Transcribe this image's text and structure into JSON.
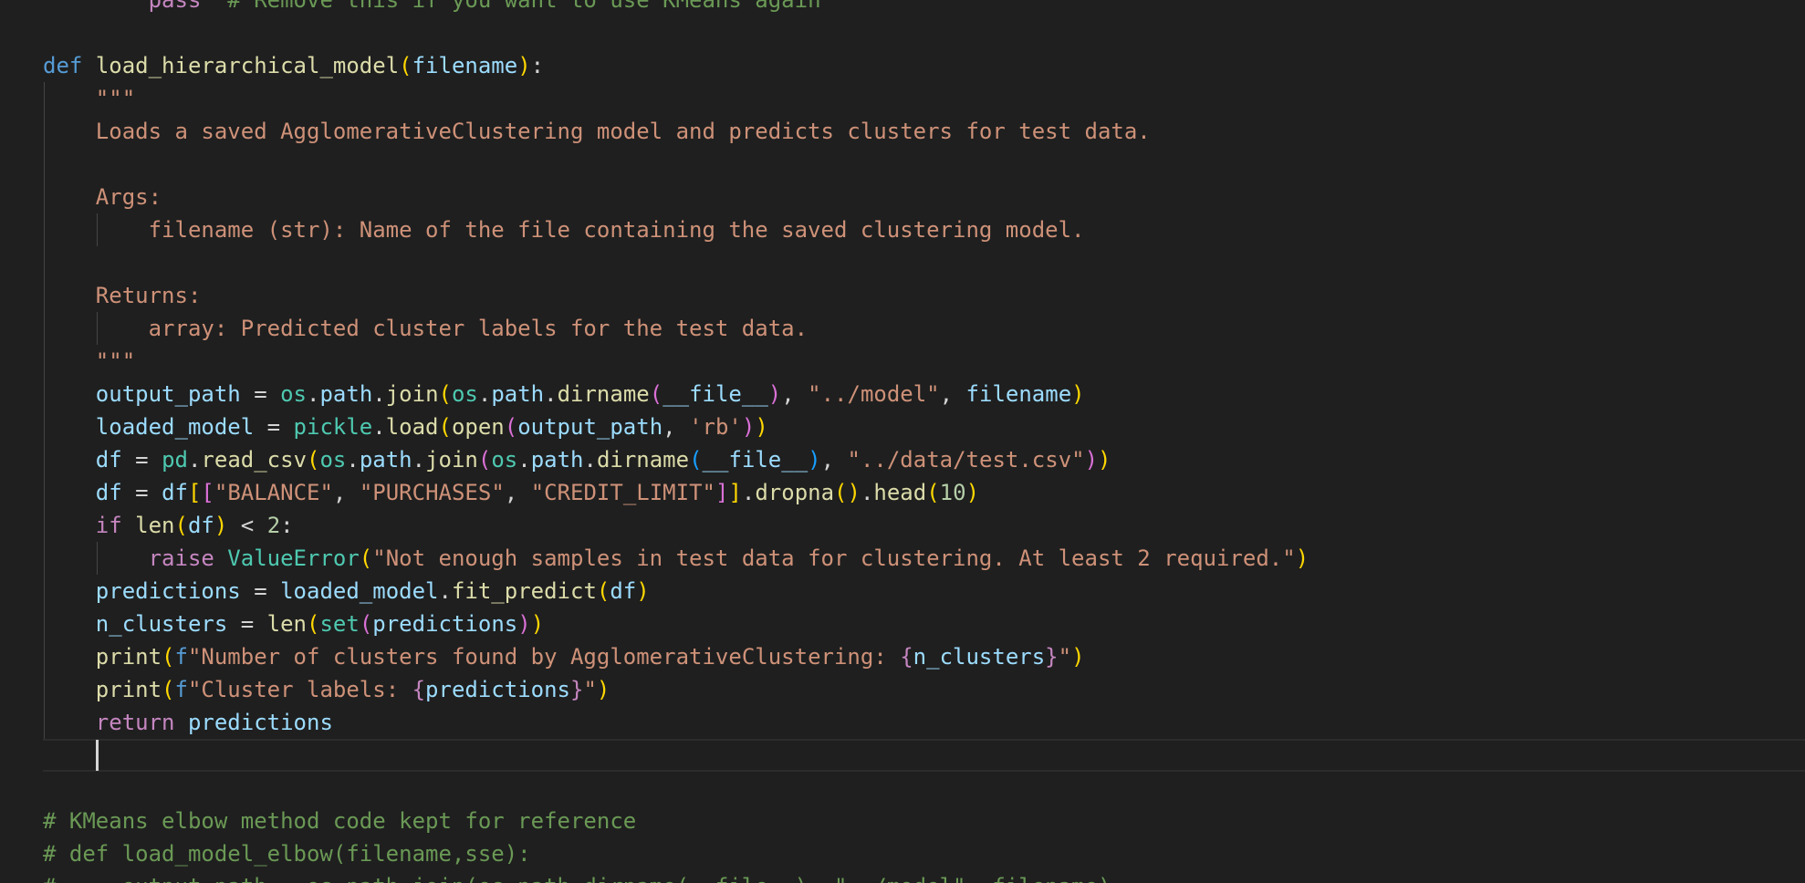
{
  "editor": {
    "theme_colors": {
      "background": "#1f1f1f",
      "keyword_control": "#c586c0",
      "keyword": "#569cd6",
      "function": "#dcdcaa",
      "string": "#ce9178",
      "variable": "#9cdcfe",
      "module": "#4ec9b0",
      "number": "#b5cea8",
      "comment": "#6a9955"
    },
    "lines": [
      [
        {
          "t": "        "
        },
        {
          "t": "pass",
          "c": "kw-ctrl"
        },
        {
          "t": "  "
        },
        {
          "t": "# Remove this if you want to use KMeans again",
          "c": "cmt"
        }
      ],
      [],
      [
        {
          "t": "def",
          "c": "kw"
        },
        {
          "t": " "
        },
        {
          "t": "load_hierarchical_model",
          "c": "fn"
        },
        {
          "t": "(",
          "c": "p1"
        },
        {
          "t": "filename",
          "c": "var"
        },
        {
          "t": ")",
          "c": "p1"
        },
        {
          "t": ":",
          "c": "op"
        }
      ],
      [
        {
          "t": "    "
        },
        {
          "t": "\"\"\"",
          "c": "str"
        }
      ],
      [
        {
          "t": "    "
        },
        {
          "t": "Loads a saved AgglomerativeClustering model and predicts clusters for test data.",
          "c": "str"
        }
      ],
      [],
      [
        {
          "t": "    "
        },
        {
          "t": "Args:",
          "c": "str"
        }
      ],
      [
        {
          "t": "        "
        },
        {
          "t": "filename (str): Name of the file containing the saved clustering model.",
          "c": "str"
        }
      ],
      [],
      [
        {
          "t": "    "
        },
        {
          "t": "Returns:",
          "c": "str"
        }
      ],
      [
        {
          "t": "        "
        },
        {
          "t": "array: Predicted cluster labels for the test data.",
          "c": "str"
        }
      ],
      [
        {
          "t": "    "
        },
        {
          "t": "\"\"\"",
          "c": "str"
        }
      ],
      [
        {
          "t": "    "
        },
        {
          "t": "output_path",
          "c": "var"
        },
        {
          "t": " = ",
          "c": "op"
        },
        {
          "t": "os",
          "c": "mod"
        },
        {
          "t": ".",
          "c": "op"
        },
        {
          "t": "path",
          "c": "var"
        },
        {
          "t": ".",
          "c": "op"
        },
        {
          "t": "join",
          "c": "fn"
        },
        {
          "t": "(",
          "c": "p1"
        },
        {
          "t": "os",
          "c": "mod"
        },
        {
          "t": ".",
          "c": "op"
        },
        {
          "t": "path",
          "c": "var"
        },
        {
          "t": ".",
          "c": "op"
        },
        {
          "t": "dirname",
          "c": "fn"
        },
        {
          "t": "(",
          "c": "p2"
        },
        {
          "t": "__file__",
          "c": "var"
        },
        {
          "t": ")",
          "c": "p2"
        },
        {
          "t": ", ",
          "c": "op"
        },
        {
          "t": "\"../model\"",
          "c": "str"
        },
        {
          "t": ", ",
          "c": "op"
        },
        {
          "t": "filename",
          "c": "var"
        },
        {
          "t": ")",
          "c": "p1"
        }
      ],
      [
        {
          "t": "    "
        },
        {
          "t": "loaded_model",
          "c": "var"
        },
        {
          "t": " = ",
          "c": "op"
        },
        {
          "t": "pickle",
          "c": "mod"
        },
        {
          "t": ".",
          "c": "op"
        },
        {
          "t": "load",
          "c": "fn"
        },
        {
          "t": "(",
          "c": "p1"
        },
        {
          "t": "open",
          "c": "fn"
        },
        {
          "t": "(",
          "c": "p2"
        },
        {
          "t": "output_path",
          "c": "var"
        },
        {
          "t": ", ",
          "c": "op"
        },
        {
          "t": "'rb'",
          "c": "str"
        },
        {
          "t": ")",
          "c": "p2"
        },
        {
          "t": ")",
          "c": "p1"
        }
      ],
      [
        {
          "t": "    "
        },
        {
          "t": "df",
          "c": "var"
        },
        {
          "t": " = ",
          "c": "op"
        },
        {
          "t": "pd",
          "c": "mod"
        },
        {
          "t": ".",
          "c": "op"
        },
        {
          "t": "read_csv",
          "c": "fn"
        },
        {
          "t": "(",
          "c": "p1"
        },
        {
          "t": "os",
          "c": "mod"
        },
        {
          "t": ".",
          "c": "op"
        },
        {
          "t": "path",
          "c": "var"
        },
        {
          "t": ".",
          "c": "op"
        },
        {
          "t": "join",
          "c": "fn"
        },
        {
          "t": "(",
          "c": "p2"
        },
        {
          "t": "os",
          "c": "mod"
        },
        {
          "t": ".",
          "c": "op"
        },
        {
          "t": "path",
          "c": "var"
        },
        {
          "t": ".",
          "c": "op"
        },
        {
          "t": "dirname",
          "c": "fn"
        },
        {
          "t": "(",
          "c": "p3"
        },
        {
          "t": "__file__",
          "c": "var"
        },
        {
          "t": ")",
          "c": "p3"
        },
        {
          "t": ", ",
          "c": "op"
        },
        {
          "t": "\"../data/test.csv\"",
          "c": "str"
        },
        {
          "t": ")",
          "c": "p2"
        },
        {
          "t": ")",
          "c": "p1"
        }
      ],
      [
        {
          "t": "    "
        },
        {
          "t": "df",
          "c": "var"
        },
        {
          "t": " = ",
          "c": "op"
        },
        {
          "t": "df",
          "c": "var"
        },
        {
          "t": "[",
          "c": "p1"
        },
        {
          "t": "[",
          "c": "p2"
        },
        {
          "t": "\"BALANCE\"",
          "c": "str"
        },
        {
          "t": ", ",
          "c": "op"
        },
        {
          "t": "\"PURCHASES\"",
          "c": "str"
        },
        {
          "t": ", ",
          "c": "op"
        },
        {
          "t": "\"CREDIT_LIMIT\"",
          "c": "str"
        },
        {
          "t": "]",
          "c": "p2"
        },
        {
          "t": "]",
          "c": "p1"
        },
        {
          "t": ".",
          "c": "op"
        },
        {
          "t": "dropna",
          "c": "fn"
        },
        {
          "t": "(",
          "c": "p1"
        },
        {
          "t": ")",
          "c": "p1"
        },
        {
          "t": ".",
          "c": "op"
        },
        {
          "t": "head",
          "c": "fn"
        },
        {
          "t": "(",
          "c": "p1"
        },
        {
          "t": "10",
          "c": "num"
        },
        {
          "t": ")",
          "c": "p1"
        }
      ],
      [
        {
          "t": "    "
        },
        {
          "t": "if",
          "c": "kw-ctrl"
        },
        {
          "t": " "
        },
        {
          "t": "len",
          "c": "fn"
        },
        {
          "t": "(",
          "c": "p1"
        },
        {
          "t": "df",
          "c": "var"
        },
        {
          "t": ")",
          "c": "p1"
        },
        {
          "t": " < ",
          "c": "op"
        },
        {
          "t": "2",
          "c": "num"
        },
        {
          "t": ":",
          "c": "op"
        }
      ],
      [
        {
          "t": "        "
        },
        {
          "t": "raise",
          "c": "kw-ctrl"
        },
        {
          "t": " "
        },
        {
          "t": "ValueError",
          "c": "mod"
        },
        {
          "t": "(",
          "c": "p1"
        },
        {
          "t": "\"Not enough samples in test data for clustering. At least 2 required.\"",
          "c": "str"
        },
        {
          "t": ")",
          "c": "p1"
        }
      ],
      [
        {
          "t": "    "
        },
        {
          "t": "predictions",
          "c": "var"
        },
        {
          "t": " = ",
          "c": "op"
        },
        {
          "t": "loaded_model",
          "c": "var"
        },
        {
          "t": ".",
          "c": "op"
        },
        {
          "t": "fit_predict",
          "c": "fn"
        },
        {
          "t": "(",
          "c": "p1"
        },
        {
          "t": "df",
          "c": "var"
        },
        {
          "t": ")",
          "c": "p1"
        }
      ],
      [
        {
          "t": "    "
        },
        {
          "t": "n_clusters",
          "c": "var"
        },
        {
          "t": " = ",
          "c": "op"
        },
        {
          "t": "len",
          "c": "fn"
        },
        {
          "t": "(",
          "c": "p1"
        },
        {
          "t": "set",
          "c": "mod"
        },
        {
          "t": "(",
          "c": "p2"
        },
        {
          "t": "predictions",
          "c": "var"
        },
        {
          "t": ")",
          "c": "p2"
        },
        {
          "t": ")",
          "c": "p1"
        }
      ],
      [
        {
          "t": "    "
        },
        {
          "t": "print",
          "c": "fn"
        },
        {
          "t": "(",
          "c": "p1"
        },
        {
          "t": "f",
          "c": "kw"
        },
        {
          "t": "\"Number of clusters found by AgglomerativeClustering: ",
          "c": "str"
        },
        {
          "t": "{",
          "c": "kw-ctrl"
        },
        {
          "t": "n_clusters",
          "c": "var"
        },
        {
          "t": "}",
          "c": "kw-ctrl"
        },
        {
          "t": "\"",
          "c": "str"
        },
        {
          "t": ")",
          "c": "p1"
        }
      ],
      [
        {
          "t": "    "
        },
        {
          "t": "print",
          "c": "fn"
        },
        {
          "t": "(",
          "c": "p1"
        },
        {
          "t": "f",
          "c": "kw"
        },
        {
          "t": "\"Cluster labels: ",
          "c": "str"
        },
        {
          "t": "{",
          "c": "kw-ctrl"
        },
        {
          "t": "predictions",
          "c": "var"
        },
        {
          "t": "}",
          "c": "kw-ctrl"
        },
        {
          "t": "\"",
          "c": "str"
        },
        {
          "t": ")",
          "c": "p1"
        }
      ],
      [
        {
          "t": "    "
        },
        {
          "t": "return",
          "c": "kw-ctrl"
        },
        {
          "t": " "
        },
        {
          "t": "predictions",
          "c": "var"
        }
      ],
      [
        {
          "t": "    "
        }
      ],
      [],
      [
        {
          "t": "# KMeans elbow method code kept for reference",
          "c": "cmt"
        }
      ],
      [
        {
          "t": "# def load_model_elbow(filename,sse):",
          "c": "cmt"
        }
      ],
      [
        {
          "t": "#     output_path = os.path.join(os.path.dirname(__file__), \"../model\", filename)",
          "c": "cmt"
        }
      ]
    ]
  }
}
